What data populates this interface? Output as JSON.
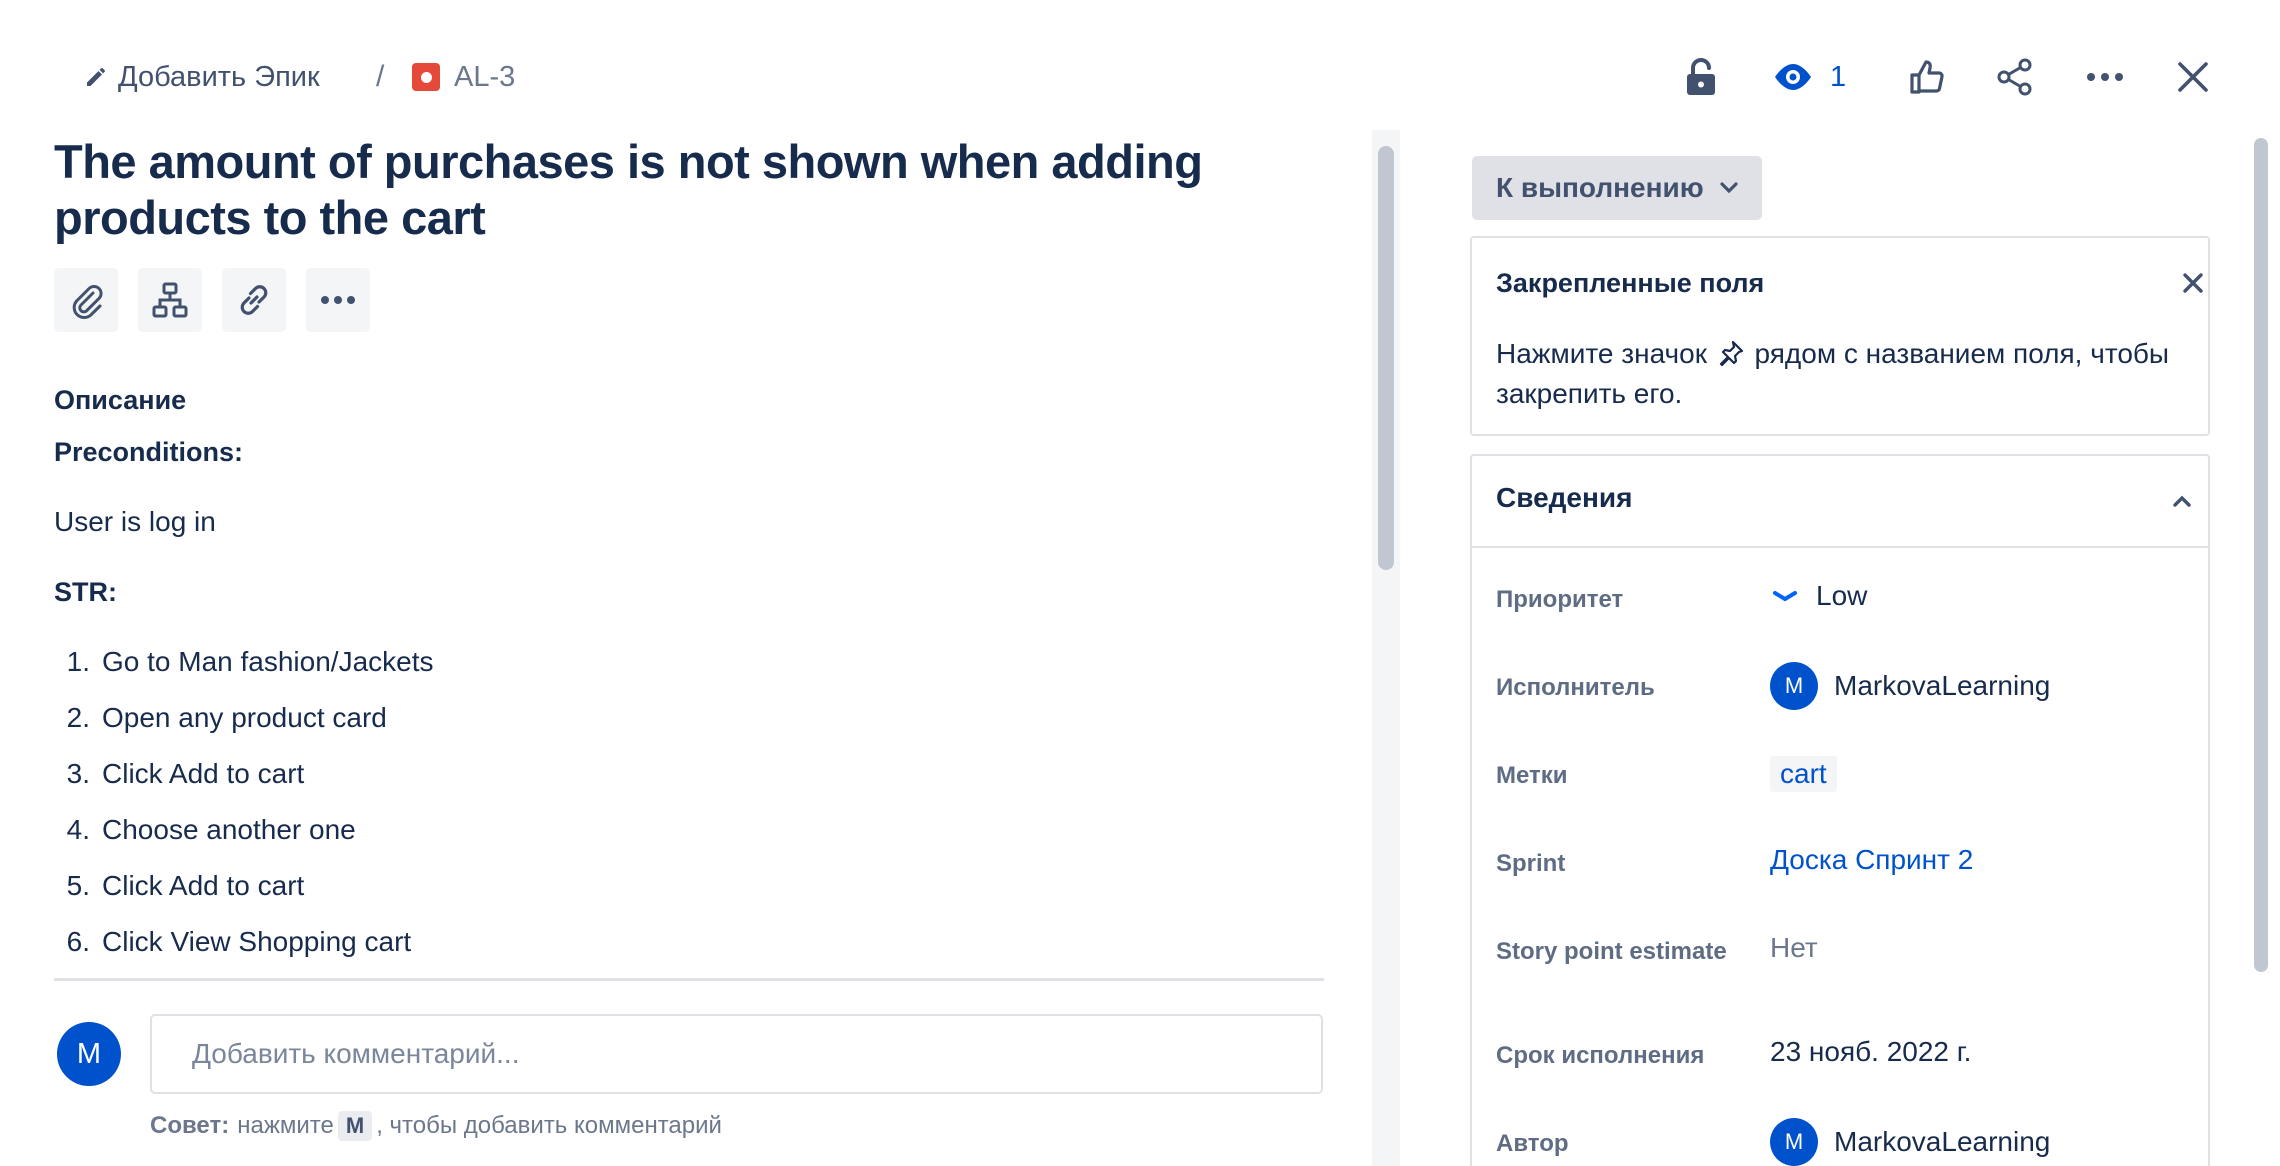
{
  "breadcrumb": {
    "epic_label": "Добавить Эпик",
    "separator": "/",
    "issue_key": "AL-3"
  },
  "toolbar": {
    "watch_count": "1"
  },
  "issue": {
    "title": "The amount of purchases is not shown when adding products to the cart"
  },
  "description": {
    "label": "Описание",
    "preconditions_label": "Preconditions:",
    "preconditions_text": "User is log in",
    "str_label": "STR:",
    "steps": [
      {
        "num": "1.",
        "text": "Go to Man fashion/Jackets"
      },
      {
        "num": "2.",
        "text": "Open any product card"
      },
      {
        "num": "3.",
        "text": "Click Add to cart"
      },
      {
        "num": "4.",
        "text": "Choose another one"
      },
      {
        "num": "5.",
        "text": "Click Add to cart"
      },
      {
        "num": "6.",
        "text": "Click View Shopping cart"
      }
    ]
  },
  "comment": {
    "avatar_initial": "M",
    "placeholder": "Добавить комментарий...",
    "tip_label": "Совет:",
    "tip_before": "нажмите",
    "tip_key": "M",
    "tip_after": ", чтобы добавить комментарий"
  },
  "status": {
    "label": "К выполнению"
  },
  "pinned": {
    "title": "Закрепленные поля",
    "text_before": "Нажмите значок",
    "text_after": "рядом с названием поля, чтобы закрепить его."
  },
  "details": {
    "title": "Сведения",
    "priority_label": "Приоритет",
    "priority_value": "Low",
    "assignee_label": "Исполнитель",
    "assignee_initial": "M",
    "assignee_value": "MarkovaLearning",
    "labels_label": "Метки",
    "labels_value": "cart",
    "sprint_label": "Sprint",
    "sprint_value": "Доска Спринт 2",
    "story_points_label": "Story point estimate",
    "story_points_value": "Нет",
    "due_label": "Срок исполнения",
    "due_value": "23 нояб. 2022 г.",
    "reporter_label": "Автор",
    "reporter_initial": "M",
    "reporter_value": "MarkovaLearning"
  },
  "colors": {
    "primary": "#0052cc",
    "text": "#172b4d",
    "bug": "#e5493a"
  }
}
